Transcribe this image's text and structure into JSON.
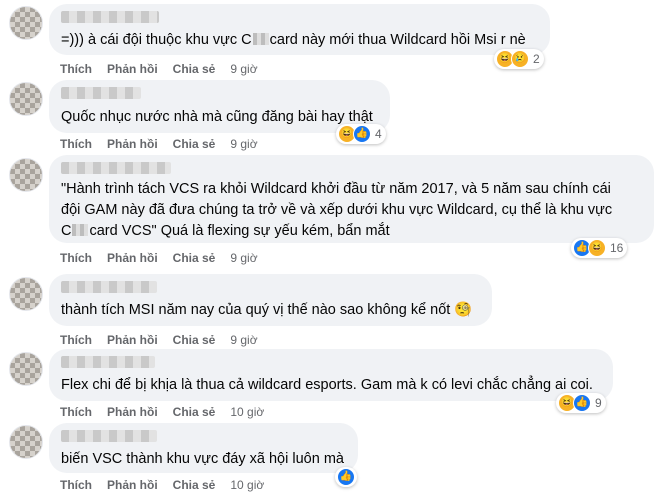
{
  "actions": {
    "like": "Thích",
    "reply": "Phản hồi",
    "share": "Chia sẻ"
  },
  "comments": [
    {
      "text_a": "=))) à cái đội thuộc khu vực C",
      "text_b": "card này mới thua Wildcard hồi Msi r nè",
      "time": "9 giờ",
      "reactions": [
        "haha-icon",
        "sad-icon"
      ],
      "count": "2"
    },
    {
      "text": "Quốc nhục nước nhà mà cũng đăng bài hay thật",
      "time": "9 giờ",
      "reactions": [
        "haha-icon",
        "like-icon"
      ],
      "count": "4"
    },
    {
      "line1": "\"Hành trình tách VCS ra khỏi Wildcard khởi đầu từ năm 2017, và 5 năm sau chính cái",
      "line2": "đội GAM này đã đưa chúng ta trở về và xếp dưới khu vực Wildcard, cụ thể là khu vực",
      "line3_a": "C",
      "line3_b": "card VCS\" Quá là flexing sự yếu kém, bẩn mắt",
      "time": "9 giờ",
      "reactions": [
        "like-icon",
        "haha-icon"
      ],
      "count": "16"
    },
    {
      "text": "thành tích MSI năm nay của quý vị thế nào sao không kể nốt 🧐",
      "time": "9 giờ",
      "reactions": [],
      "count": ""
    },
    {
      "text": "Flex chi để bị khịa là thua cả wildcard esports. Gam mà k có levi chắc chẳng ai coi.",
      "time": "10 giờ",
      "reactions": [
        "haha-icon",
        "like-icon"
      ],
      "count": "9"
    },
    {
      "text": "biến VSC thành khu vực đáy xã hội luôn mà",
      "time": "10 giờ",
      "reactions": [
        "like-icon"
      ],
      "count": ""
    }
  ]
}
